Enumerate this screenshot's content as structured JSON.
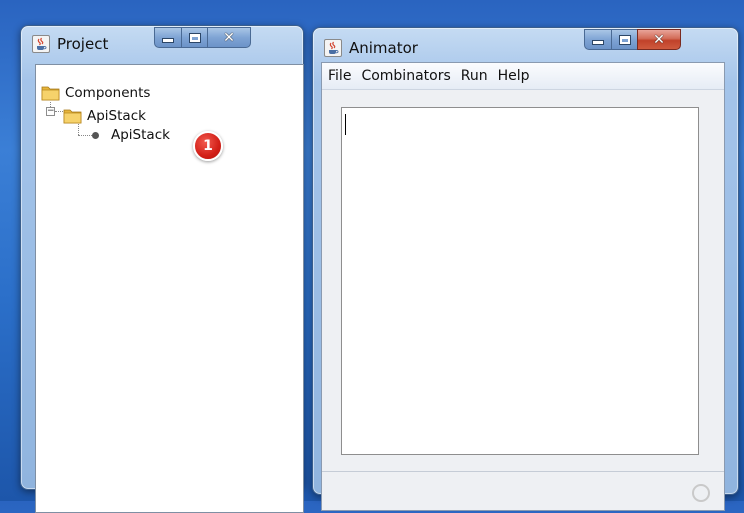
{
  "project_window": {
    "title": "Project",
    "tree": {
      "root_label": "Components",
      "folder_label": "ApiStack",
      "leaf_label": "ApiStack",
      "toggle_symbol": "−"
    },
    "callout_number": "1"
  },
  "animator_window": {
    "title": "Animator",
    "menu": [
      "File",
      "Combinators",
      "Run",
      "Help"
    ],
    "editor_value": ""
  },
  "icons": {
    "app": "java-coffee-icon",
    "folder": "folder-icon",
    "minimize": "minimize-icon",
    "maximize": "maximize-icon",
    "close": "close-icon",
    "busy": "busy-spinner-icon"
  },
  "colors": {
    "desktop": "#2b6fc9",
    "close_button": "#c0412a",
    "callout_badge": "#d21f17"
  }
}
